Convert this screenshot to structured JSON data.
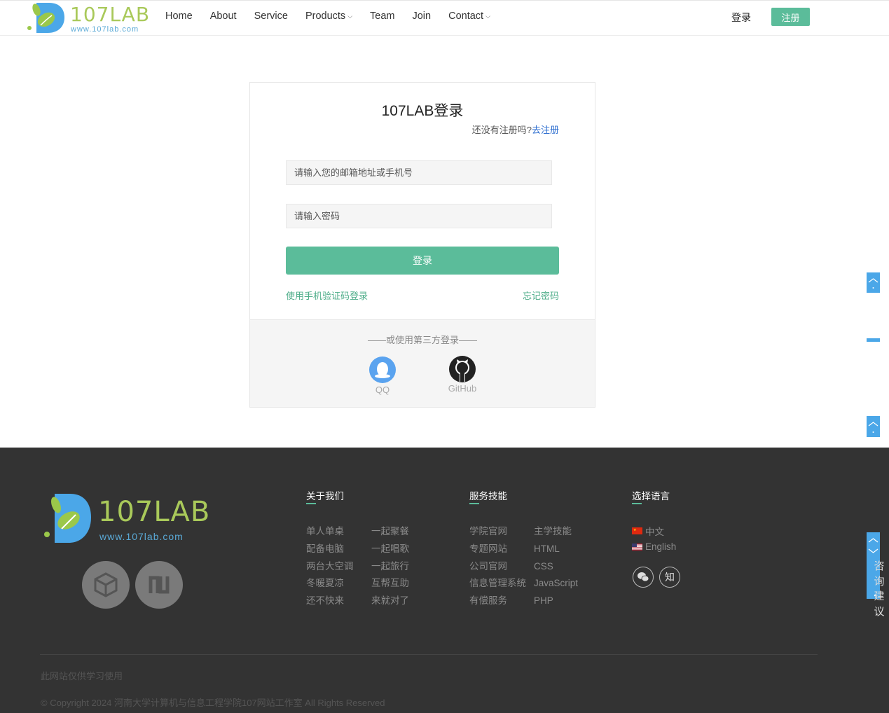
{
  "header": {
    "brand": "107LAB",
    "url": "www.107lab.com",
    "nav": [
      {
        "label": "Home"
      },
      {
        "label": "About"
      },
      {
        "label": "Service"
      },
      {
        "label": "Products",
        "caret": "⌵"
      },
      {
        "label": "Team"
      },
      {
        "label": "Join"
      },
      {
        "label": "Contact",
        "caret": "⌵"
      }
    ],
    "login_label": "登录",
    "register_label": "注册"
  },
  "login": {
    "title": "107LAB登录",
    "no_account": "还没有注册吗?",
    "go_register": "去注册",
    "email_placeholder": "请输入您的邮箱地址或手机号",
    "password_placeholder": "请输入密码",
    "submit_label": "登录",
    "sms_login": "使用手机验证码登录",
    "forgot": "忘记密码",
    "third_party_title": "——或使用第三方登录——",
    "qq_label": "QQ",
    "github_label": "GitHub"
  },
  "footer": {
    "brand": "107LAB",
    "url": "www.107lab.com",
    "about_title": "关于我们",
    "about_col1": [
      "单人单桌",
      "配备电脑",
      "两台大空调",
      "冬暖夏凉",
      "还不快来"
    ],
    "about_col2": [
      "一起聚餐",
      "一起唱歌",
      "一起旅行",
      "互帮互助",
      "来就对了"
    ],
    "service_title": "服务技能",
    "service_col1": [
      "学院官网",
      "专题网站",
      "公司官网",
      "信息管理系统",
      "有偿服务"
    ],
    "service_col2": [
      "主学技能",
      "HTML",
      "CSS",
      "JavaScript",
      "PHP"
    ],
    "lang_title": "选择语言",
    "lang_zh": "中文",
    "lang_en": "English",
    "zhihu_glyph": "知",
    "note": "此网站仅供学习使用",
    "copyright": "© Copyright 2024 河南大学计算机与信息工程学院107网站工作室 All Rights Reserved",
    "consult_text": "咨询建议"
  },
  "colors": {
    "accent": "#5bbc9a",
    "link_blue": "#2f6fd0",
    "side_blue": "#4ba7e8",
    "footer_bg": "#333333",
    "brand_green": "#a9c95a"
  }
}
